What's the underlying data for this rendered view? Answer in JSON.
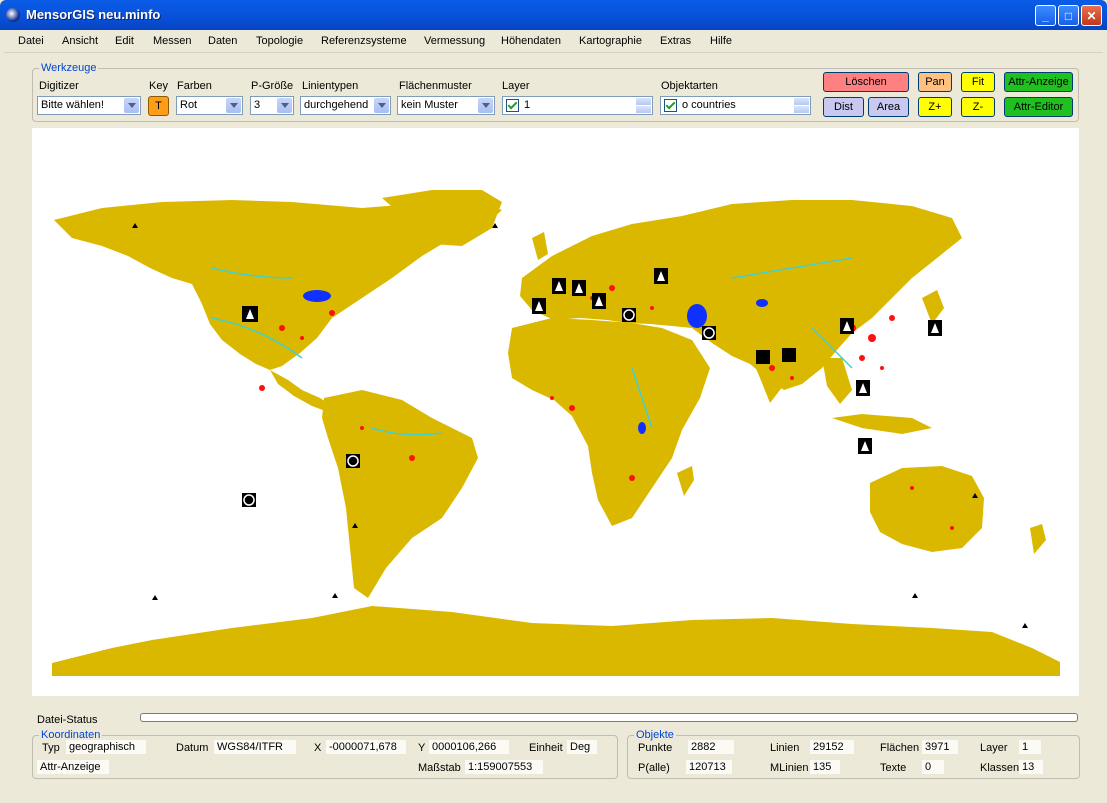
{
  "window": {
    "title": "MensorGIS neu.minfo",
    "min": "_",
    "max": "□",
    "close": "✕"
  },
  "menu": [
    "Datei",
    "Ansicht",
    "Edit",
    "Messen",
    "Daten",
    "Topologie",
    "Referenzsysteme",
    "Vermessung",
    "Höhendaten",
    "Kartographie",
    "Extras",
    "Hilfe"
  ],
  "werkzeuge": {
    "legend": "Werkzeuge",
    "digitizer": {
      "label": "Digitizer",
      "value": "Bitte wählen!"
    },
    "key": {
      "label": "Key",
      "value": "T"
    },
    "farben": {
      "label": "Farben",
      "value": "Rot"
    },
    "pgroesse": {
      "label": "P-Größe",
      "value": "3"
    },
    "linientypen": {
      "label": "Linientypen",
      "value": "durchgehend"
    },
    "flaechenmuster": {
      "label": "Flächenmuster",
      "value": "kein Muster"
    },
    "layer": {
      "label": "Layer",
      "value": "1"
    },
    "objektarten": {
      "label": "Objektarten",
      "value": "o countries"
    }
  },
  "buttons": {
    "loeschen": "Löschen",
    "pan": "Pan",
    "fit": "Fit",
    "attr_anzeige": "Attr-Anzeige",
    "dist": "Dist",
    "area": "Area",
    "zplus": "Z+",
    "zminus": "Z-",
    "attr_editor": "Attr-Editor"
  },
  "status": {
    "label": "Datei-Status"
  },
  "koordinaten": {
    "legend": "Koordinaten",
    "typ_label": "Typ",
    "typ": "geographisch",
    "datum_label": "Datum",
    "datum": "WGS84/ITFR",
    "x_label": "X",
    "x": "-0000071,678",
    "y_label": "Y",
    "y": "0000106,266",
    "einheit_label": "Einheit",
    "einheit": "Deg",
    "attr_anzeige": "Attr-Anzeige",
    "massstab_label": "Maßstab",
    "massstab": "1:159007553"
  },
  "objekte": {
    "legend": "Objekte",
    "punkte_label": "Punkte",
    "punkte": "2882",
    "linien_label": "Linien",
    "linien": "29152",
    "flaechen_label": "Flächen",
    "flaechen": "3971",
    "layer_label": "Layer",
    "layer": "1",
    "palle_label": "P(alle)",
    "palle": "120713",
    "mlinien_label": "MLinien",
    "mlinien": "135",
    "texte_label": "Texte",
    "texte": "0",
    "klassen_label": "Klassen",
    "klassen": "13"
  },
  "colors": {
    "land": "#dbb800",
    "rivers": "#40d0d0",
    "lakes": "#1030ff",
    "cities": "#ff1010",
    "loeschen": "#ff8080",
    "pan": "#ffc080",
    "fit": "#ffff00",
    "attr": "#20c020",
    "dist": "#c8c8f0"
  },
  "map_icons": [
    "mountain-icon",
    "crosshair-icon",
    "moon-icon",
    "fish-icon"
  ]
}
